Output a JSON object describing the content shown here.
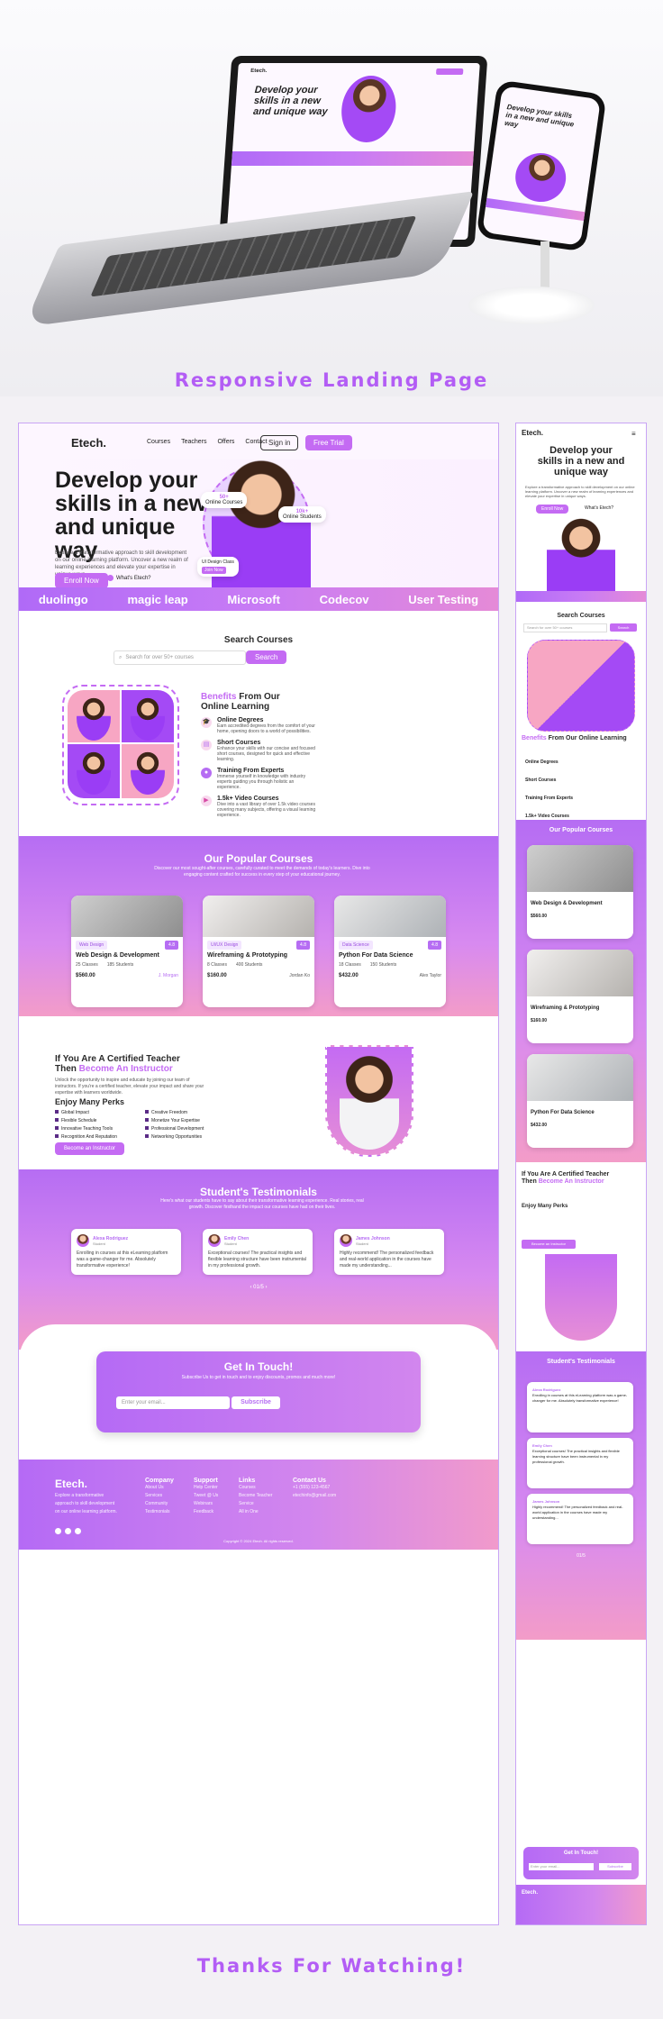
{
  "showcase": {
    "title": "Responsive Landing Page",
    "footer_title": "Thanks For Watching!"
  },
  "nav": {
    "logo": "Etech.",
    "items": [
      "Courses",
      "Teachers",
      "Offers",
      "Contact"
    ],
    "sign_in": "Sign in",
    "free_trial": "Free Trial"
  },
  "hero": {
    "title": "Develop your skills in a new and unique way",
    "description": "Explore a transformative approach to skill development on our online learning platform. Uncover a new realm of learning experiences and elevate your expertise in unique ways.",
    "enroll": "Enroll Now",
    "what_is": "What's Etech?",
    "stat_courses_value": "50+",
    "stat_courses_label": "Online Courses",
    "stat_students_value": "10k+",
    "stat_students_label": "Online Students",
    "tutor_name": "UI Design Class",
    "tutor_cta": "Join Now"
  },
  "partners": [
    "duolingo",
    "magic leap",
    "Microsoft",
    "Codecov",
    "User Testing"
  ],
  "search": {
    "title": "Search Courses",
    "placeholder": "Search for over 50+ courses",
    "button": "Search"
  },
  "benefits": {
    "title_accent": "Benefits",
    "title_rest": "From Our Online Learning",
    "items": [
      {
        "title": "Online Degrees",
        "text": "Earn accredited degrees from the comfort of your home, opening doors to a world of possibilities."
      },
      {
        "title": "Short Courses",
        "text": "Enhance your skills with our concise and focused short courses, designed for quick and effective learning."
      },
      {
        "title": "Training From Experts",
        "text": "Immerse yourself in knowledge with industry experts guiding you through holistic an experience."
      },
      {
        "title": "1.5k+ Video Courses",
        "text": "Dive into a vast library of over 1.5k video courses covering many subjects, offering a visual learning experience."
      }
    ]
  },
  "popular": {
    "title": "Our Popular Courses",
    "subtitle": "Discover our most sought-after courses, carefully curated to meet the demands of today's learners. Dive into engaging content crafted for success in every step of your educational journey.",
    "courses": [
      {
        "tag": "Web Design",
        "rating": "4.8",
        "title": "Web Design & Development",
        "classes": "25 Classes",
        "students": "185 Students",
        "price": "$560.00",
        "author": "J. Morgan"
      },
      {
        "tag": "UI/UX Design",
        "rating": "4.8",
        "title": "Wireframing & Prototyping",
        "classes": "8 Classes",
        "students": "400 Students",
        "price": "$160.00",
        "author": "Jordan Ko"
      },
      {
        "tag": "Data Science",
        "rating": "4.8",
        "title": "Python For Data Science",
        "classes": "18 Classes",
        "students": "150 Students",
        "price": "$432.00",
        "author": "Alex Taylor"
      }
    ]
  },
  "teacher": {
    "title_line1": "If You Are A Certified Teacher",
    "title_line2_plain": "Then",
    "title_line2_accent": "Become An Instructor",
    "description": "Unlock the opportunity to inspire and educate by joining our team of instructors. If you're a certified teacher, elevate your impact and share your expertise with learners worldwide.",
    "perks_title": "Enjoy Many Perks",
    "perks": [
      "Global Impact",
      "Creative Freedom",
      "Flexible Schedule",
      "Monetize Your Expertise",
      "Innovative Teaching Tools",
      "Professional Development",
      "Recognition And Reputation",
      "Networking Opportunities"
    ],
    "button": "Become an Instructor"
  },
  "testimonials": {
    "title": "Student's Testimonials",
    "subtitle": "Here's what our students have to say about their transformative learning experience. Real stories, real growth. Discover firsthand the impact our courses have had on their lives.",
    "items": [
      {
        "name": "Alexa Rodriguez",
        "role": "Student",
        "text": "Enrolling in courses at this eLearning platform was a game-changer for me. Absolutely transformative experience!"
      },
      {
        "name": "Emily Chen",
        "role": "Student",
        "text": "Exceptional courses! The practical insights and flexible learning structure have been instrumental in my professional growth."
      },
      {
        "name": "James Johnson",
        "role": "Student",
        "text": "Highly recommend! The personalized feedback and real-world application in the courses have made my understanding..."
      }
    ],
    "pager": "01/5"
  },
  "contact": {
    "title": "Get In Touch!",
    "subtitle": "Subscribe Us to get in touch and to enjoy discounts, promos and much more!",
    "placeholder": "Enter your email...",
    "button": "Subscribe"
  },
  "footer": {
    "logo": "Etech.",
    "about": "Explore a transformative approach to skill development on our online learning platform.",
    "columns": [
      {
        "title": "Company",
        "links": [
          "About Us",
          "Services",
          "Community",
          "Testimonials"
        ]
      },
      {
        "title": "Support",
        "links": [
          "Help Center",
          "Tweet @ Us",
          "Webinars",
          "Feedback"
        ]
      },
      {
        "title": "Links",
        "links": [
          "Courses",
          "Become Teacher",
          "Service",
          "All in One"
        ]
      },
      {
        "title": "Contact Us",
        "links": [
          "+1 (555) 123-4567",
          "etechinfo@gmail.com"
        ]
      }
    ],
    "copyright": "Copyright © 2024 Etech. All rights reserved."
  },
  "mobile": {
    "benefits_title_accent": "Benefits",
    "benefits_title_rest": "From Our Online Learning",
    "teacher_accent": "Become An Instructor",
    "pager": "01/5"
  }
}
